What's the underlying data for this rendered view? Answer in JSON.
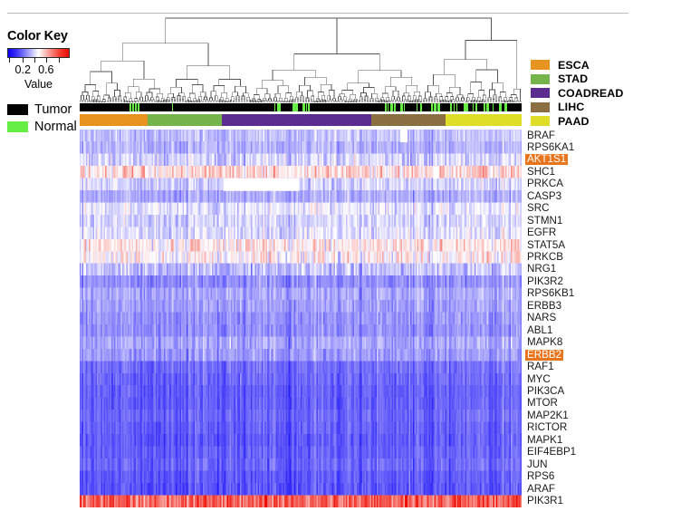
{
  "color_key": {
    "title": "Color Key",
    "tick_labels": [
      "0.2",
      "0.6"
    ],
    "tick_label_positions": [
      0.25,
      0.62
    ],
    "tick_positions": [
      0.03,
      0.25,
      0.44,
      0.62,
      0.82
    ],
    "axis_label": "Value",
    "gradient": [
      "#0b00f6",
      "#ffffff",
      "#ee0b00"
    ]
  },
  "sample_type_legend": {
    "items": [
      {
        "label": "Tumor",
        "color": "#000000"
      },
      {
        "label": "Normal",
        "color": "#66ee44"
      }
    ]
  },
  "cancer_type_legend": {
    "items": [
      {
        "label": "ESCA",
        "color": "#e6941f"
      },
      {
        "label": "STAD",
        "color": "#74b44a"
      },
      {
        "label": "COADREAD",
        "color": "#5b2d90"
      },
      {
        "label": "LIHC",
        "color": "#8b6f43"
      },
      {
        "label": "PAAD",
        "color": "#dede28"
      }
    ]
  },
  "cancer_type_bar": {
    "blocks": [
      {
        "type": "ESCA",
        "color": "#e6941f",
        "start": 0.0,
        "end": 0.154
      },
      {
        "type": "STAD",
        "color": "#74b44a",
        "start": 0.154,
        "end": 0.322
      },
      {
        "type": "COADREAD",
        "color": "#5b2d90",
        "start": 0.322,
        "end": 0.66
      },
      {
        "type": "LIHC",
        "color": "#8b6f43",
        "start": 0.66,
        "end": 0.828
      },
      {
        "type": "PAAD",
        "color": "#dede28",
        "start": 0.828,
        "end": 1.0
      }
    ]
  },
  "sample_type_bar": {
    "background": "#000000",
    "normal_color": "#66ee44",
    "normal_fractions": [
      0.112,
      0.118,
      0.126,
      0.132,
      0.208,
      0.44,
      0.447,
      0.452,
      0.481,
      0.487,
      0.505,
      0.512,
      0.517,
      0.69,
      0.697,
      0.703,
      0.712,
      0.726,
      0.733,
      0.762,
      0.771,
      0.795,
      0.802,
      0.809,
      0.838,
      0.846,
      0.852,
      0.869,
      0.875,
      0.889,
      0.896,
      0.913,
      0.921,
      0.934,
      0.948,
      0.962
    ]
  },
  "genes": [
    {
      "name": "BRAF",
      "highlight": false
    },
    {
      "name": "RPS6KA1",
      "highlight": false
    },
    {
      "name": "AKT1S1",
      "highlight": true
    },
    {
      "name": "SHC1",
      "highlight": false
    },
    {
      "name": "PRKCA",
      "highlight": false
    },
    {
      "name": "CASP3",
      "highlight": false
    },
    {
      "name": "SRC",
      "highlight": false
    },
    {
      "name": "STMN1",
      "highlight": false
    },
    {
      "name": "EGFR",
      "highlight": false
    },
    {
      "name": "STAT5A",
      "highlight": false
    },
    {
      "name": "PRKCB",
      "highlight": false
    },
    {
      "name": "NRG1",
      "highlight": false
    },
    {
      "name": "PIK3R2",
      "highlight": false
    },
    {
      "name": "RPS6KB1",
      "highlight": false
    },
    {
      "name": "ERBB3",
      "highlight": false
    },
    {
      "name": "NARS",
      "highlight": false
    },
    {
      "name": "ABL1",
      "highlight": false
    },
    {
      "name": "MAPK8",
      "highlight": false
    },
    {
      "name": "ERBB2",
      "highlight": true
    },
    {
      "name": "RAF1",
      "highlight": false
    },
    {
      "name": "MYC",
      "highlight": false
    },
    {
      "name": "PIK3CA",
      "highlight": false
    },
    {
      "name": "MTOR",
      "highlight": false
    },
    {
      "name": "MAP2K1",
      "highlight": false
    },
    {
      "name": "RICTOR",
      "highlight": false
    },
    {
      "name": "MAPK1",
      "highlight": false
    },
    {
      "name": "EIF4EBP1",
      "highlight": false
    },
    {
      "name": "JUN",
      "highlight": false
    },
    {
      "name": "RPS6",
      "highlight": false
    },
    {
      "name": "ARAF",
      "highlight": false
    },
    {
      "name": "PIK3R1",
      "highlight": false
    }
  ],
  "highlight_color": "#e8741c",
  "chart_data": {
    "type": "heatmap",
    "title": "",
    "xlabel": "",
    "ylabel": "",
    "columns": 330,
    "rows": 31,
    "value_range": [
      0.0,
      0.8
    ],
    "colormap": "blue-white-red",
    "row_labels": [
      "BRAF",
      "RPS6KA1",
      "AKT1S1",
      "SHC1",
      "PRKCA",
      "CASP3",
      "SRC",
      "STMN1",
      "EGFR",
      "STAT5A",
      "PRKCB",
      "NRG1",
      "PIK3R2",
      "RPS6KB1",
      "ERBB3",
      "NARS",
      "ABL1",
      "MAPK8",
      "ERBB2",
      "RAF1",
      "MYC",
      "PIK3CA",
      "MTOR",
      "MAP2K1",
      "RICTOR",
      "MAPK1",
      "EIF4EBP1",
      "JUN",
      "RPS6",
      "ARAF",
      "PIK3R1"
    ],
    "row_profiles": [
      {
        "label": "BRAF",
        "mean": 0.3,
        "spread": 0.05
      },
      {
        "label": "RPS6KA1",
        "mean": 0.28,
        "spread": 0.05
      },
      {
        "label": "AKT1S1",
        "mean": 0.33,
        "spread": 0.09
      },
      {
        "label": "SHC1",
        "mean": 0.46,
        "spread": 0.12
      },
      {
        "label": "PRKCA",
        "mean": 0.33,
        "spread": 0.07
      },
      {
        "label": "CASP3",
        "mean": 0.27,
        "spread": 0.05
      },
      {
        "label": "SRC",
        "mean": 0.36,
        "spread": 0.08
      },
      {
        "label": "STMN1",
        "mean": 0.33,
        "spread": 0.07
      },
      {
        "label": "EGFR",
        "mean": 0.35,
        "spread": 0.08
      },
      {
        "label": "STAT5A",
        "mean": 0.44,
        "spread": 0.11
      },
      {
        "label": "PRKCB",
        "mean": 0.42,
        "spread": 0.12
      },
      {
        "label": "NRG1",
        "mean": 0.3,
        "spread": 0.09
      },
      {
        "label": "PIK3R2",
        "mean": 0.22,
        "spread": 0.05
      },
      {
        "label": "RPS6KB1",
        "mean": 0.26,
        "spread": 0.05
      },
      {
        "label": "ERBB3",
        "mean": 0.25,
        "spread": 0.05
      },
      {
        "label": "NARS",
        "mean": 0.23,
        "spread": 0.05
      },
      {
        "label": "ABL1",
        "mean": 0.22,
        "spread": 0.04
      },
      {
        "label": "MAPK8",
        "mean": 0.26,
        "spread": 0.06
      },
      {
        "label": "ERBB2",
        "mean": 0.24,
        "spread": 0.06
      },
      {
        "label": "RAF1",
        "mean": 0.17,
        "spread": 0.04
      },
      {
        "label": "MYC",
        "mean": 0.16,
        "spread": 0.04
      },
      {
        "label": "PIK3CA",
        "mean": 0.15,
        "spread": 0.03
      },
      {
        "label": "MTOR",
        "mean": 0.15,
        "spread": 0.03
      },
      {
        "label": "MAP2K1",
        "mean": 0.16,
        "spread": 0.03
      },
      {
        "label": "RICTOR",
        "mean": 0.15,
        "spread": 0.03
      },
      {
        "label": "MAPK1",
        "mean": 0.14,
        "spread": 0.03
      },
      {
        "label": "EIF4EBP1",
        "mean": 0.15,
        "spread": 0.03
      },
      {
        "label": "JUN",
        "mean": 0.16,
        "spread": 0.04
      },
      {
        "label": "RPS6",
        "mean": 0.14,
        "spread": 0.03
      },
      {
        "label": "ARAF",
        "mean": 0.13,
        "spread": 0.04
      },
      {
        "label": "PIK3R1",
        "mean": 0.66,
        "spread": 0.14
      }
    ],
    "missing_blocks": [
      {
        "row": 4,
        "col_start": 0.325,
        "col_end": 0.497
      },
      {
        "row": 0,
        "col_start": 0.725,
        "col_end": 0.742
      },
      {
        "row": 3,
        "col_start": 0.8,
        "col_end": 0.812
      }
    ]
  },
  "dendrogram": {
    "leaves": 330,
    "line_color": "#555555",
    "orientation": "top"
  }
}
